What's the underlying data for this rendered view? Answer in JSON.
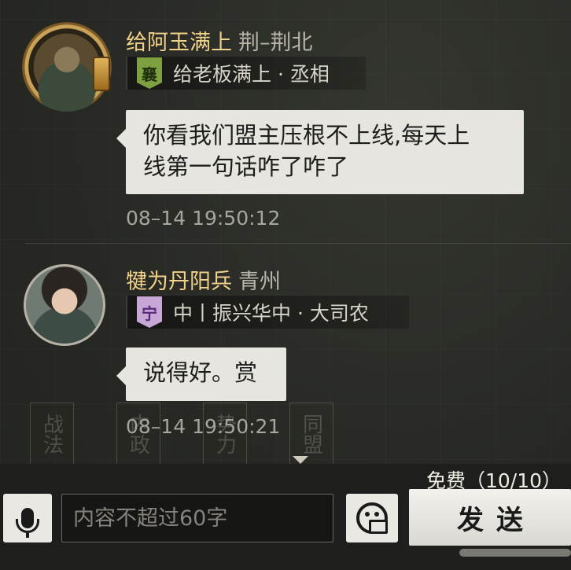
{
  "messages": [
    {
      "sender": "给阿玉满上",
      "region": "荆–荆北",
      "alliance_badge": "襄",
      "alliance_text": "给老板满上 · 丞相",
      "text_line1": "你看我们盟主压根不上线,每天上",
      "text_line2": "线第一句话咋了咋了",
      "timestamp": "08–14 19:50:12"
    },
    {
      "sender": "犍为丹阳兵",
      "region": "青州",
      "alliance_badge": "宁",
      "alliance_text": "中丨振兴华中 · 大司农",
      "text": "说得好。赏",
      "timestamp": "08–14 19:50:21"
    }
  ],
  "background_menu": [
    "战法",
    "内政",
    "势力",
    "同盟"
  ],
  "footer": {
    "quota": "免费（10/10）",
    "input_placeholder": "内容不超过60字",
    "send_label": "发送"
  },
  "colors": {
    "sender_name": "#f0d28a",
    "bubble": "#e6e5e0",
    "badge_green": "#7ea040",
    "badge_purple": "#c6a7d6"
  }
}
